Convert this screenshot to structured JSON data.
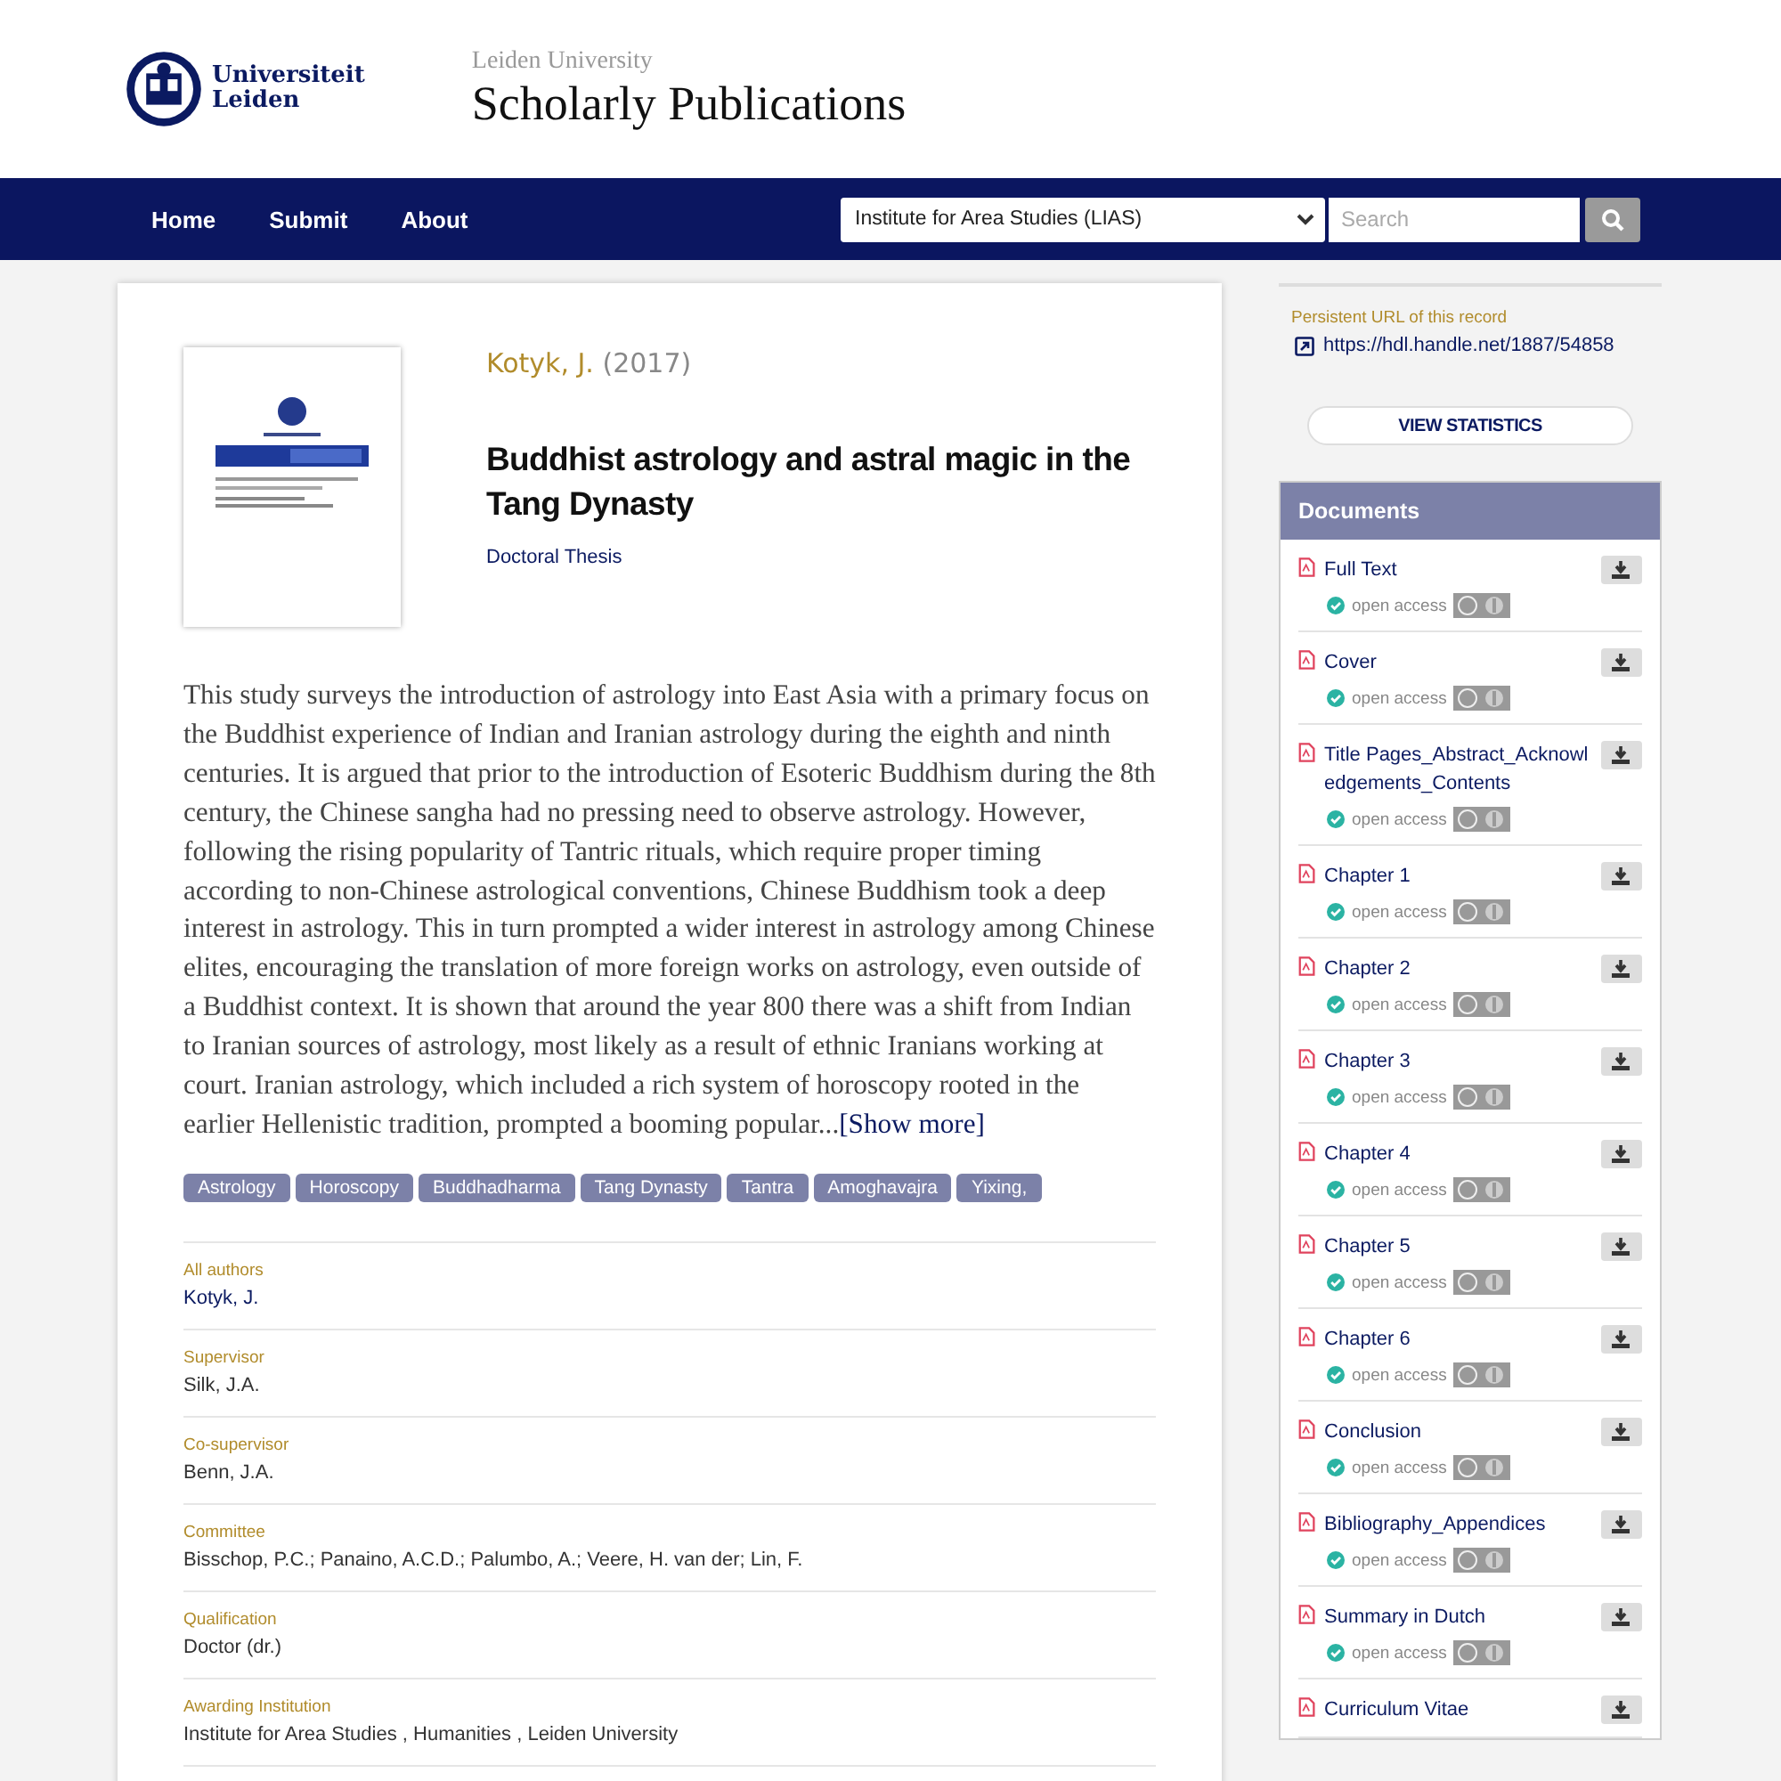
{
  "header": {
    "logo_lines": [
      "Universiteit",
      "Leiden"
    ],
    "subtitle": "Leiden University",
    "title": "Scholarly Publications"
  },
  "nav": {
    "links": [
      "Home",
      "Submit",
      "About"
    ],
    "scope": "Institute for Area Studies (LIAS)",
    "search": {
      "placeholder": "Search"
    }
  },
  "record": {
    "author": "Kotyk, J.",
    "year": "(2017)",
    "title": "Buddhist astrology and astral magic in the Tang Dynasty",
    "type": "Doctoral Thesis",
    "abstract": "This study surveys the introduction of astrology into East Asia with a primary focus on the Buddhist experience of Indian and Iranian astrology during the eighth and ninth centuries. It is argued that prior to the introduction of Esoteric Buddhism during the 8th century, the Chinese sangha had no pressing need to observe astrology. However, following the rising popularity of Tantric rituals, which require proper timing according to non-Chinese astrological conventions, Chinese Buddhism took a deep interest in astrology. This in turn prompted a wider interest in astrology among Chinese elites, encouraging the translation of more foreign works on astrology, even outside of a Buddhist context. It is shown that around the year 800 there was a shift from Indian to Iranian sources of astrology, most likely as a result of ethnic Iranians working at court. Iranian astrology, which included a rich system of horoscopy rooted in the earlier Hellenistic tradition, prompted a booming popular...",
    "show_more": "[Show more]",
    "keywords": [
      "Astrology",
      "Horoscopy",
      "Buddhadharma",
      "Tang Dynasty",
      "Tantra",
      "Amoghavajra",
      "Yixing,"
    ],
    "fields": [
      {
        "label": "All authors",
        "value": "Kotyk, J.",
        "kind": "link"
      },
      {
        "label": "Supervisor",
        "value": "Silk, J.A.",
        "kind": "text"
      },
      {
        "label": "Co-supervisor",
        "value": "Benn, J.A.",
        "kind": "text"
      },
      {
        "label": "Committee",
        "value": "Bisschop, P.C.; Panaino, A.C.D.; Palumbo, A.; Veere, H. van der; Lin, F.",
        "kind": "text"
      },
      {
        "label": "Qualification",
        "value": "Doctor (dr.)",
        "kind": "text"
      },
      {
        "label": "Awarding Institution",
        "value": "Institute for Area Studies , Humanities , Leiden University",
        "kind": "text"
      }
    ]
  },
  "sidebar": {
    "persistent_label": "Persistent URL of this record",
    "url": "https://hdl.handle.net/1887/54858",
    "stats_button": "VIEW STATISTICS",
    "documents": {
      "title": "Documents",
      "items": [
        {
          "title": "Full Text",
          "access": "open access"
        },
        {
          "title": "Cover",
          "access": "open access"
        },
        {
          "title": "Title Pages_Abstract_Acknowledgements_Contents",
          "access": "open access"
        },
        {
          "title": "Chapter 1",
          "access": "open access"
        },
        {
          "title": "Chapter 2",
          "access": "open access"
        },
        {
          "title": "Chapter 3",
          "access": "open access"
        },
        {
          "title": "Chapter 4",
          "access": "open access"
        },
        {
          "title": "Chapter 5",
          "access": "open access"
        },
        {
          "title": "Chapter 6",
          "access": "open access"
        },
        {
          "title": "Conclusion",
          "access": "open access"
        },
        {
          "title": "Bibliography_Appendices",
          "access": "open access"
        },
        {
          "title": "Summary in Dutch",
          "access": "open access"
        },
        {
          "title": "Curriculum Vitae"
        }
      ]
    }
  }
}
